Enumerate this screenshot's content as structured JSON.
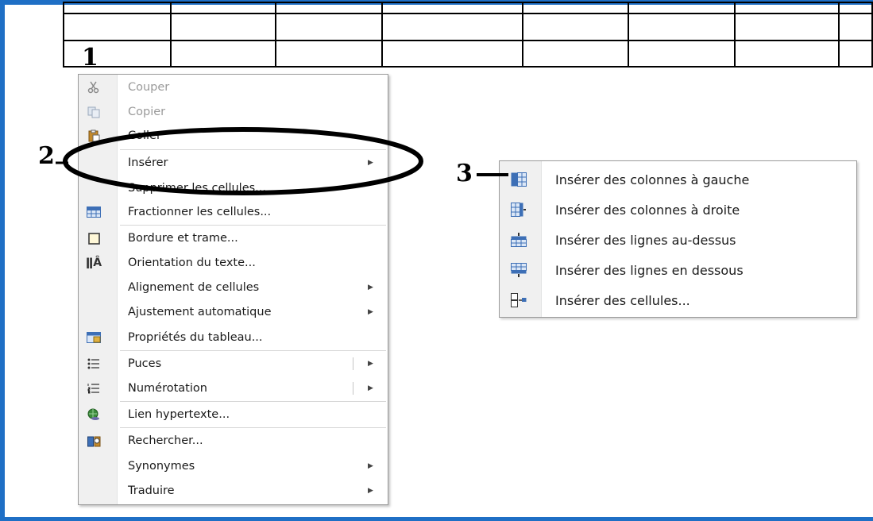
{
  "annotations": {
    "marker_1": "1",
    "marker_2": "2",
    "marker_3": "3"
  },
  "context_menu": {
    "items": [
      {
        "label": "Couper",
        "icon": "scissors-icon",
        "disabled": true
      },
      {
        "label": "Copier",
        "icon": "copy-icon",
        "disabled": true
      },
      {
        "label": "Coller",
        "icon": "paste-icon",
        "disabled": false
      },
      {
        "label": "Insérer",
        "icon": "",
        "submenu": true
      },
      {
        "label": "Supprimer les cellules...",
        "icon": ""
      },
      {
        "label": "Fractionner les cellules...",
        "icon": "split-cells-icon"
      },
      {
        "label": "Bordure et trame...",
        "icon": "borders-icon"
      },
      {
        "label": "Orientation du texte...",
        "icon": "text-direction-icon"
      },
      {
        "label": "Alignement de cellules",
        "icon": "",
        "submenu": true
      },
      {
        "label": "Ajustement automatique",
        "icon": "",
        "submenu": true
      },
      {
        "label": "Propriétés du tableau...",
        "icon": "table-properties-icon"
      },
      {
        "label": "Puces",
        "icon": "bullets-icon",
        "submenu": true
      },
      {
        "label": "Numérotation",
        "icon": "numbering-icon",
        "submenu": true
      },
      {
        "label": "Lien hypertexte...",
        "icon": "hyperlink-icon"
      },
      {
        "label": "Rechercher...",
        "icon": "research-icon"
      },
      {
        "label": "Synonymes",
        "icon": "",
        "submenu": true
      },
      {
        "label": "Traduire",
        "icon": "",
        "submenu": true
      }
    ]
  },
  "submenu": {
    "items": [
      {
        "label": "Insérer des colonnes à gauche",
        "icon": "insert-columns-left-icon"
      },
      {
        "label": "Insérer des colonnes à droite",
        "icon": "insert-columns-right-icon"
      },
      {
        "label": "Insérer des lignes au-dessus",
        "icon": "insert-rows-above-icon"
      },
      {
        "label": "Insérer des lignes en dessous",
        "icon": "insert-rows-below-icon"
      },
      {
        "label": "Insérer des cellules...",
        "icon": "insert-cells-icon"
      }
    ]
  },
  "colors": {
    "frame": "#1f6fc5",
    "menu_gutter": "#f0f0f0",
    "icon_blue": "#3d6fb6"
  }
}
